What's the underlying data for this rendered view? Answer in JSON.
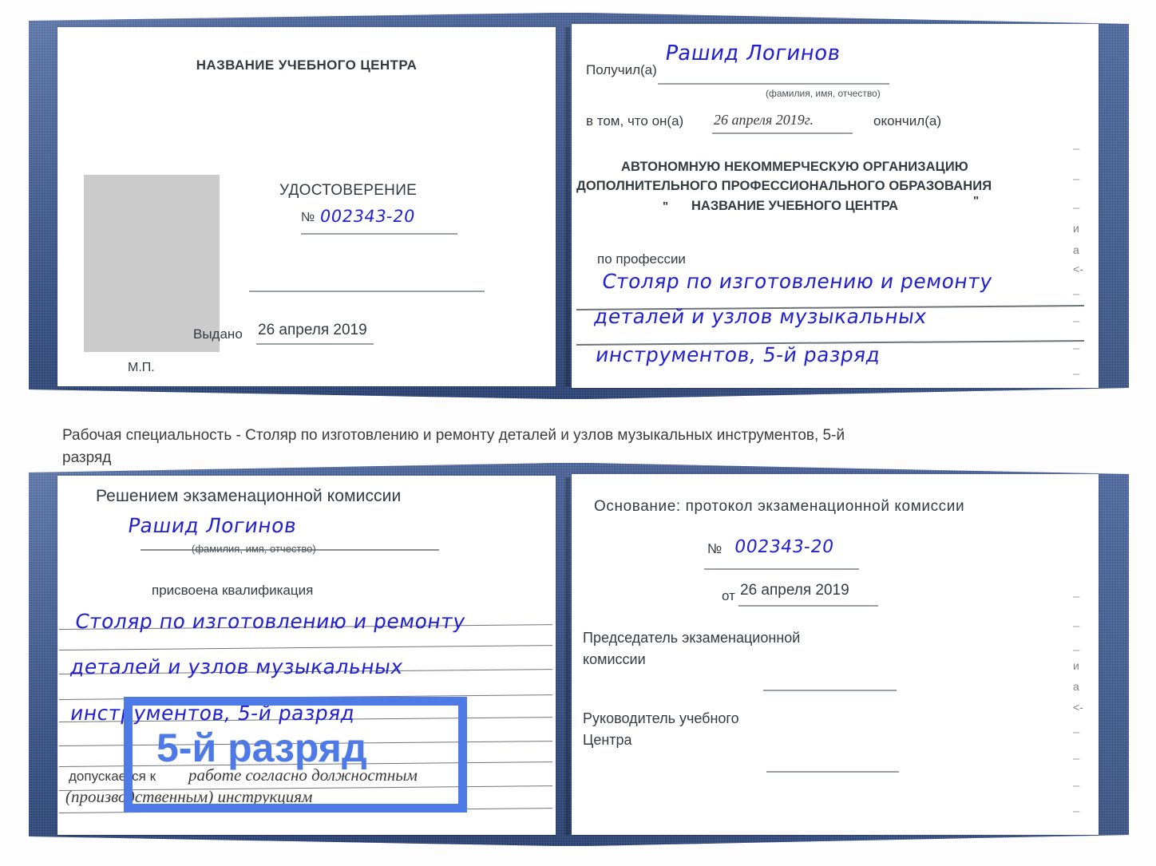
{
  "caption": {
    "text": "Рабочая специальность - Столяр по изготовлению и ремонту деталей и узлов музыкальных инструментов, 5-й разряд"
  },
  "colors": {
    "cover_blue": "#27488a",
    "highlight_blue": "#4d7ae6",
    "ink_blue": "#2121d0",
    "paper_white": "#ffffff",
    "photo_gray": "#cbcbcb",
    "print_text": "#333a42"
  },
  "highlight": {
    "label": "5-й разряд"
  },
  "certificate_top": {
    "left_page": {
      "header": "НАЗВАНИЕ УЧЕБНОГО ЦЕНТРА",
      "title": "УДОСТОВЕРЕНИЕ",
      "number_label": "№",
      "number_value": "002343-20",
      "issued_label": "Выдано",
      "issued_value": "26 апреля 2019",
      "seal_label": "М.П.",
      "photo_placeholder": "photo-placeholder"
    },
    "right_page": {
      "received_label": "Получил(а)",
      "received_value": "Рашид Логинов",
      "fio_hint": "(фамилия, имя, отчество)",
      "that_he_label": "в том, что он(а)",
      "that_he_value": "26 апреля 2019г.",
      "graduated_label": "окончил(а)",
      "org_line_1": "АВТОНОМНУЮ НЕКОММЕРЧЕСКУЮ ОРГАНИЗАЦИЮ",
      "org_line_2": "ДОПОЛНИТЕЛЬНОГО ПРОФЕССИОНАЛЬНОГО ОБРАЗОВАНИЯ",
      "org_quote_open": "\"",
      "org_line_3": "НАЗВАНИЕ УЧЕБНОГО ЦЕНТРА",
      "org_quote_close": "\"",
      "profession_label": "по профессии",
      "profession_line_1": "Столяр по изготовлению и ремонту",
      "profession_line_2": "деталей и узлов музыкальных",
      "profession_line_3": "инструментов, 5-й разряд",
      "margin_fragments": [
        "и",
        "а",
        "<-"
      ]
    }
  },
  "certificate_bottom": {
    "left_page": {
      "header": "Решением экзаменационной комиссии",
      "name_value": "Рашид Логинов",
      "fio_hint": "(фамилия, имя, отчество)",
      "qualification_label": "присвоена квалификация",
      "qualification_line_1": "Столяр по изготовлению и ремонту",
      "qualification_line_2": "деталей и узлов музыкальных",
      "qualification_line_3": "инструментов, 5-й разряд",
      "admitted_label": "допускается к",
      "admitted_value_line_1": "работе согласно должностным",
      "admitted_value_line_2": "(производственным) инструкциям"
    },
    "right_page": {
      "basis_label": "Основание: протокол экзаменационной комиссии",
      "number_label": "№",
      "number_value": "002343-20",
      "date_label": "от",
      "date_value": "26 апреля 2019",
      "chairman_line_1": "Председатель экзаменационной",
      "chairman_line_2": "комиссии",
      "director_line_1": "Руководитель учебного",
      "director_line_2": "Центра",
      "margin_fragments": [
        "и",
        "а",
        "<-"
      ]
    }
  }
}
